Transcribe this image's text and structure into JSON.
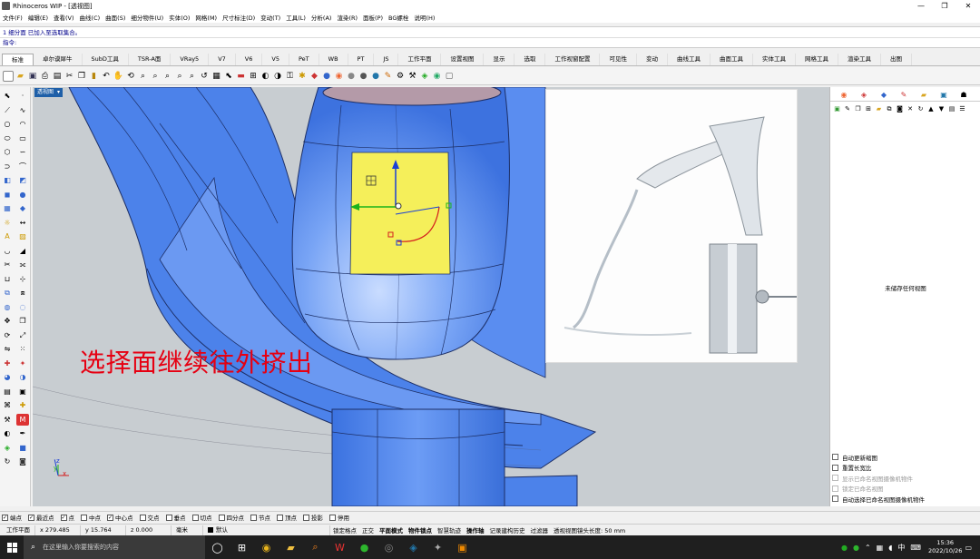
{
  "window": {
    "title": "Rhinoceros WIP - [透视图]",
    "controls": [
      "—",
      "❐",
      "✕"
    ]
  },
  "menu": [
    "文件(F)",
    "编辑(E)",
    "查看(V)",
    "曲线(C)",
    "曲面(S)",
    "细分物件(U)",
    "实体(O)",
    "网格(M)",
    "尺寸标注(D)",
    "变动(T)",
    "工具(L)",
    "分析(A)",
    "渲染(R)",
    "面板(P)",
    "BG螺栓",
    "说明(H)"
  ],
  "command": {
    "history": "1 细分面 已加入至选取集合。",
    "prompt": "指令:"
  },
  "tabs": [
    "标准",
    "卓尔谟犀牛",
    "SubD工具",
    "TSR-A面",
    "VRay5",
    "V7",
    "V6",
    "V5",
    "PeT",
    "WB",
    "PT",
    "JS",
    "工作平面",
    "设置视图",
    "显示",
    "选取",
    "工作视窗配置",
    "可见性",
    "变动",
    "曲线工具",
    "曲面工具",
    "实体工具",
    "网格工具",
    "渲染工具",
    "出图"
  ],
  "active_tab": "标准",
  "viewport": {
    "label": "透视图",
    "caption": "选择面继续往外挤出",
    "axes": {
      "x": "x",
      "y": "y",
      "z": "z"
    }
  },
  "right_panel": {
    "empty_text": "未储存任何视图",
    "options": [
      {
        "label": "自动更新缩图",
        "enabled": true
      },
      {
        "label": "重置长宽比",
        "enabled": true
      },
      {
        "label": "显示已命名视图摄像机物件",
        "enabled": false
      },
      {
        "label": "锁定已命名视图",
        "enabled": false
      },
      {
        "label": "自动选择已命名视图摄像机物件",
        "enabled": true
      }
    ]
  },
  "osnaps": [
    {
      "label": "端点",
      "checked": true
    },
    {
      "label": "最近点",
      "checked": true
    },
    {
      "label": "点",
      "checked": true
    },
    {
      "label": "中点",
      "checked": false
    },
    {
      "label": "中心点",
      "checked": true
    },
    {
      "label": "交点",
      "checked": false
    },
    {
      "label": "垂点",
      "checked": false
    },
    {
      "label": "切点",
      "checked": false
    },
    {
      "label": "四分点",
      "checked": false
    },
    {
      "label": "节点",
      "checked": false
    },
    {
      "label": "顶点",
      "checked": false
    },
    {
      "label": "投影",
      "checked": false
    },
    {
      "label": "停用",
      "checked": false
    }
  ],
  "status": {
    "cplane": "工作平面",
    "x": "x 279.485",
    "y": "y 15.764",
    "z": "z 0.000",
    "units": "毫米",
    "layer": "默认",
    "toggles": [
      {
        "label": "锁定格点",
        "bold": false
      },
      {
        "label": "正交",
        "bold": false
      },
      {
        "label": "平面模式",
        "bold": true
      },
      {
        "label": "物件锁点",
        "bold": true
      },
      {
        "label": "智慧轨迹",
        "bold": false
      },
      {
        "label": "操作轴",
        "bold": true
      },
      {
        "label": "记录建构历史",
        "bold": false
      },
      {
        "label": "过滤器",
        "bold": false
      },
      {
        "label": "透视视图镜头长度: 50 mm",
        "bold": false
      }
    ]
  },
  "taskbar": {
    "search_placeholder": "在这里输入你要搜索的内容",
    "time": "15:36",
    "date": "2022/10/26",
    "ime": "中"
  },
  "colors": {
    "model_blue": "#5b8ff0",
    "model_blue_dark": "#3a6fd9",
    "selected_face": "#f5ef5a",
    "caption_red": "#e60012",
    "viewport_bg": "#c8cdd1",
    "viewport_tab": "#1e5fa8"
  }
}
